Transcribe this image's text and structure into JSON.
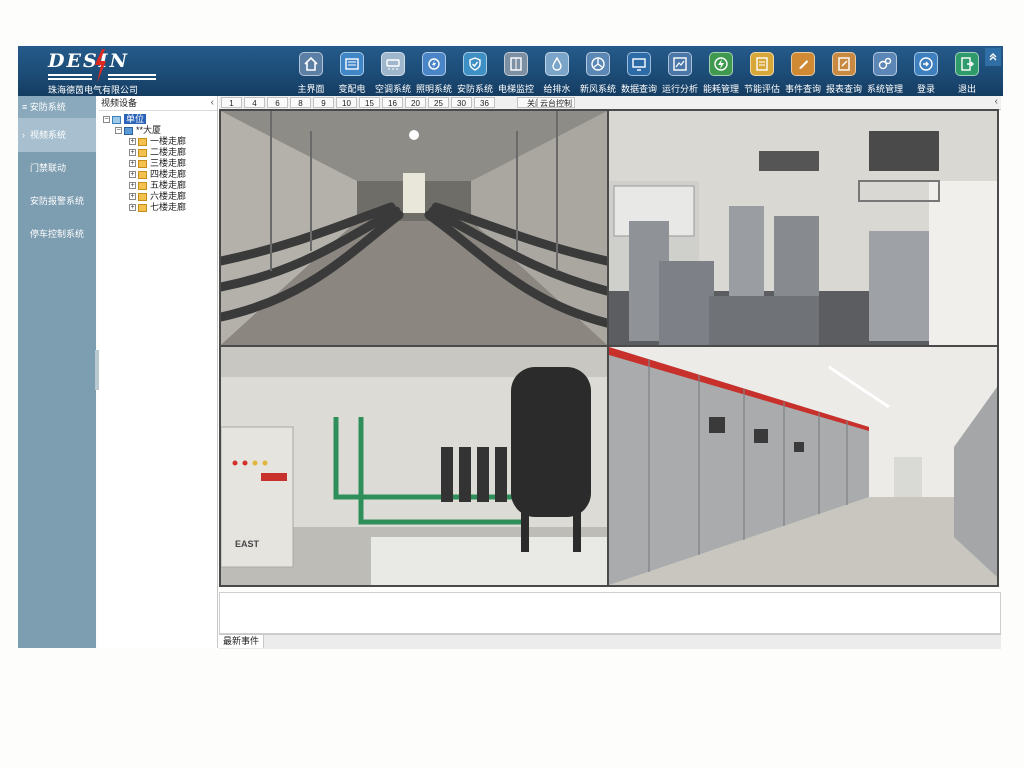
{
  "header": {
    "logo_word": "DESIN",
    "company": "珠海德茵电气有限公司",
    "nav": [
      {
        "label": "主界面",
        "icon": "home-icon"
      },
      {
        "label": "变配电",
        "icon": "power-distribution-icon"
      },
      {
        "label": "空调系统",
        "icon": "air-conditioner-icon"
      },
      {
        "label": "照明系统",
        "icon": "lighting-icon"
      },
      {
        "label": "安防系统",
        "icon": "shield-icon"
      },
      {
        "label": "电梯监控",
        "icon": "elevator-icon"
      },
      {
        "label": "给排水",
        "icon": "water-drop-icon"
      },
      {
        "label": "新风系统",
        "icon": "fan-icon"
      },
      {
        "label": "数据查询",
        "icon": "monitor-icon"
      },
      {
        "label": "运行分析",
        "icon": "chart-icon"
      },
      {
        "label": "能耗管理",
        "icon": "energy-icon"
      },
      {
        "label": "节能评估",
        "icon": "assessment-icon"
      },
      {
        "label": "事件查询",
        "icon": "event-icon"
      },
      {
        "label": "报表查询",
        "icon": "report-icon"
      },
      {
        "label": "系统管理",
        "icon": "gears-icon"
      },
      {
        "label": "登录",
        "icon": "login-icon"
      },
      {
        "label": "退出",
        "icon": "exit-icon"
      }
    ]
  },
  "left_menu": {
    "title": "安防系统",
    "items": [
      {
        "label": "视频系统",
        "active": true
      },
      {
        "label": "门禁联动",
        "active": false
      },
      {
        "label": "安防报警系统",
        "active": false
      },
      {
        "label": "停车控制系统",
        "active": false
      }
    ]
  },
  "tree": {
    "title": "视频设备",
    "root": "单位",
    "building": "**大厦",
    "corridors": [
      "一楼走廊",
      "二楼走廊",
      "三楼走廊",
      "四楼走廊",
      "五楼走廊",
      "六楼走廊",
      "七楼走廊"
    ]
  },
  "toolbar": {
    "layouts": [
      "1",
      "4",
      "6",
      "8",
      "9",
      "10",
      "15",
      "16",
      "20",
      "25",
      "30",
      "36"
    ],
    "close": "关闭",
    "ptz": "云台控制"
  },
  "cameras": [
    {
      "scene": "cable-tunnel"
    },
    {
      "scene": "equipment-room"
    },
    {
      "scene": "pump-room",
      "cabinet_text": "EAST"
    },
    {
      "scene": "switchgear-room"
    }
  ],
  "events": {
    "tab": "最新事件"
  },
  "colors": {
    "header": "#1c4c77",
    "menu": "#7d9db1",
    "menu_active": "#a7bfce",
    "tree_selection": "#2a62b8"
  }
}
